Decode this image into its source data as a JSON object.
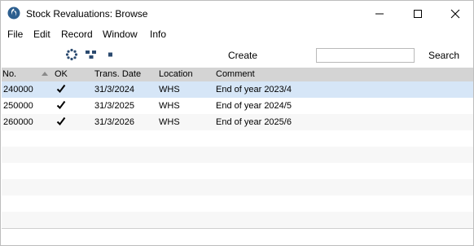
{
  "window": {
    "title": "Stock Revaluations: Browse"
  },
  "menu": [
    "File",
    "Edit",
    "Record",
    "Window",
    "Info"
  ],
  "toolbar": {
    "create_label": "Create",
    "search_label": "Search",
    "search_value": ""
  },
  "table": {
    "columns": [
      "No.",
      "OK",
      "Trans. Date",
      "Location",
      "Comment"
    ],
    "sort_column": "No.",
    "rows": [
      {
        "no": "240000",
        "ok": true,
        "date": "31/3/2024",
        "location": "WHS",
        "comment": "End of year 2023/4",
        "selected": true
      },
      {
        "no": "250000",
        "ok": true,
        "date": "31/3/2025",
        "location": "WHS",
        "comment": "End of year 2024/5",
        "selected": false
      },
      {
        "no": "260000",
        "ok": true,
        "date": "31/3/2026",
        "location": "WHS",
        "comment": "End of year 2025/6",
        "selected": false
      }
    ]
  },
  "colors": {
    "header_bg": "#d4d4d4",
    "selected_row": "#d6e6f7",
    "stripe_row": "#f7f7f7"
  },
  "icons": {
    "app": "app-logo-icon",
    "tb1": "gear-dots-icon",
    "tb2": "hierarchy-icon",
    "tb3": "square-icon",
    "min": "minimize-icon",
    "max": "maximize-icon",
    "close": "close-icon",
    "ok": "checkmark-icon"
  }
}
